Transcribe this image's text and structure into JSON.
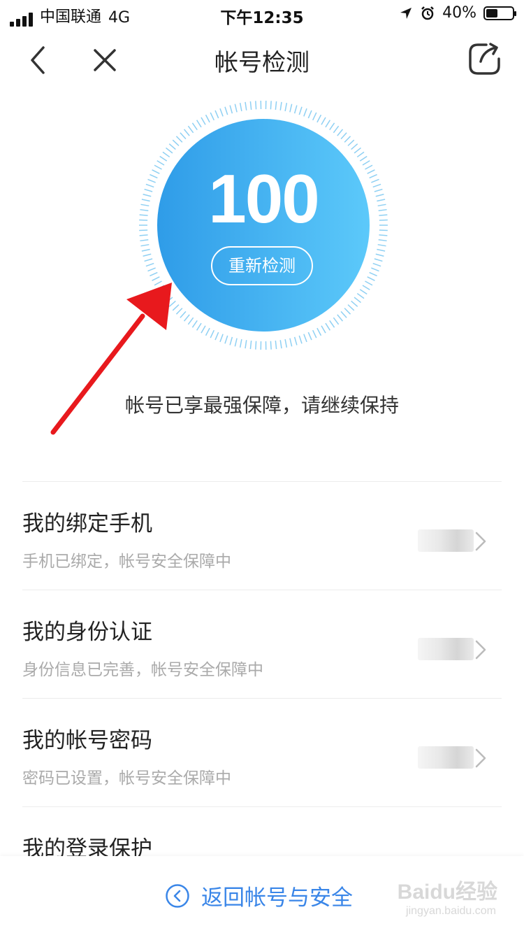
{
  "status_bar": {
    "carrier": "中国联通",
    "network": "4G",
    "time": "下午12:35",
    "battery": "40%",
    "battery_level": 0.4
  },
  "nav": {
    "title": "帐号检测",
    "back_icon": "chevron-left-icon",
    "close_icon": "close-icon",
    "share_icon": "share-icon"
  },
  "score": {
    "value": "100",
    "recheck_label": "重新检测",
    "gradient": [
      "#2f9ce8",
      "#5cc9fa"
    ]
  },
  "status_message": "帐号已享最强保障，请继续保持",
  "items": [
    {
      "title": "我的绑定手机",
      "subtitle": "手机已绑定，帐号安全保障中"
    },
    {
      "title": "我的身份认证",
      "subtitle": "身份信息已完善，帐号安全保障中"
    },
    {
      "title": "我的帐号密码",
      "subtitle": "密码已设置，帐号安全保障中"
    },
    {
      "title": "我的登录保护",
      "subtitle": ""
    }
  ],
  "bottom": {
    "back_label": "返回帐号与安全",
    "accent": "#3a86e8",
    "watermark": "Baidu经验",
    "watermark_sub": "jingyan.baidu.com"
  }
}
